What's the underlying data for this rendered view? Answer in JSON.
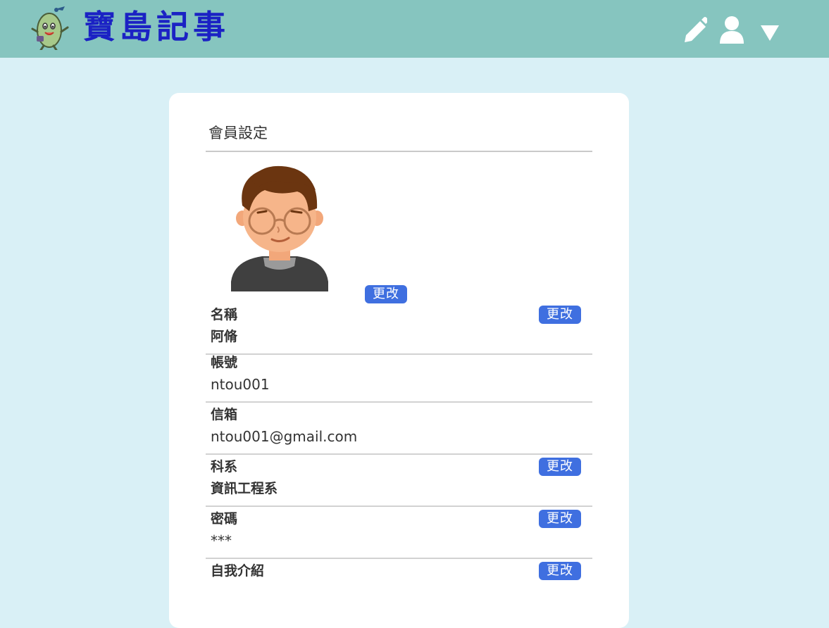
{
  "header": {
    "logo_text": "寶島記事",
    "icons": [
      "mascot-logo",
      "pencil-icon",
      "user-icon",
      "caret-down-icon"
    ]
  },
  "colors": {
    "header_bg": "#86c5bf",
    "page_bg": "#d9f0f6",
    "logo_text": "#1b22c4",
    "button_bg": "#3f6fe0"
  },
  "settings": {
    "title": "會員設定",
    "avatar_change_label": "更改",
    "fields": [
      {
        "label": "名稱",
        "value": "阿脩",
        "change_label": "更改"
      },
      {
        "label": "帳號",
        "value": "ntou001"
      },
      {
        "label": "信箱",
        "value": "ntou001@gmail.com"
      },
      {
        "label": "科系",
        "value": "資訊工程系",
        "change_label": "更改"
      },
      {
        "label": "密碼",
        "value": "***",
        "change_label": "更改"
      },
      {
        "label": "自我介紹",
        "value": "",
        "change_label": "更改"
      }
    ]
  }
}
